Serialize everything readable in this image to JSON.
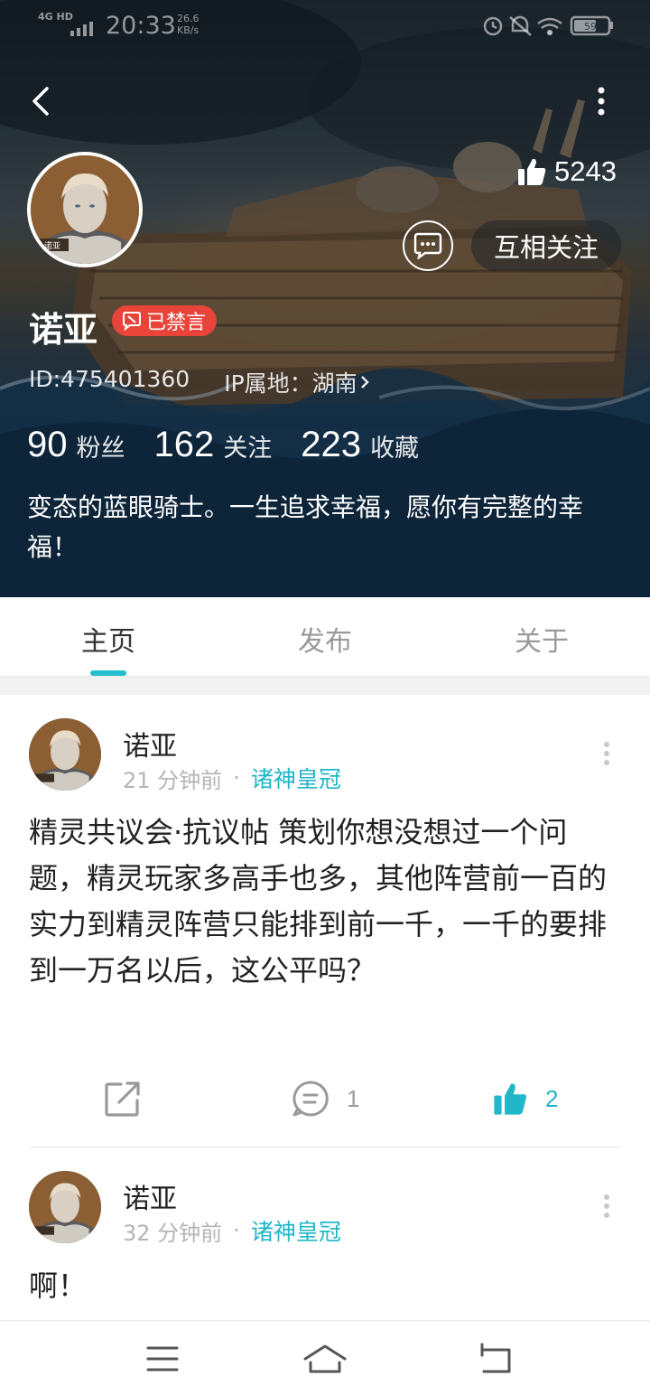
{
  "status_bar": {
    "network": "4G HD",
    "time": "20:33",
    "speed_value": "26.6",
    "speed_unit": "KB/s",
    "battery": "59"
  },
  "profile": {
    "name": "诺亚",
    "badge_text": "已禁言",
    "id_text": "ID:475401360",
    "ip_text": "IP属地：湖南",
    "likes": "5243",
    "follow_label": "互相关注",
    "stats": [
      {
        "number": "90",
        "label": "粉丝"
      },
      {
        "number": "162",
        "label": "关注"
      },
      {
        "number": "223",
        "label": "收藏"
      }
    ],
    "bio": "变态的蓝眼骑士。一生追求幸福，愿你有完整的幸福！",
    "avatar_tag": "诺亚"
  },
  "tabs": [
    {
      "label": "主页",
      "active": true
    },
    {
      "label": "发布",
      "active": false
    },
    {
      "label": "关于",
      "active": false
    }
  ],
  "posts": [
    {
      "author": "诺亚",
      "time": "21 分钟前",
      "separator": "·",
      "topic": "诸神皇冠",
      "content": "精灵共议会·抗议帖 策划你想没想过一个问题，精灵玩家多高手也多，其他阵营前一百的实力到精灵阵营只能排到前一千，一千的要排到一万名以后，这公平吗？",
      "comments": "1",
      "likes": "2"
    },
    {
      "author": "诺亚",
      "time": "32 分钟前",
      "separator": "·",
      "topic": "诸神皇冠",
      "content": "啊！"
    }
  ],
  "colors": {
    "accent": "#21b6c8",
    "banned_badge": "#e8443a",
    "tab_indicator": "#23bfcf"
  },
  "icons": {
    "back": "chevron-left-icon",
    "more": "vertical-dots-icon",
    "like": "thumbs-up-icon",
    "message": "chat-bubble-icon",
    "share": "share-icon",
    "comment": "comment-icon",
    "nav": [
      "menu-icon",
      "home-icon",
      "return-icon"
    ]
  }
}
